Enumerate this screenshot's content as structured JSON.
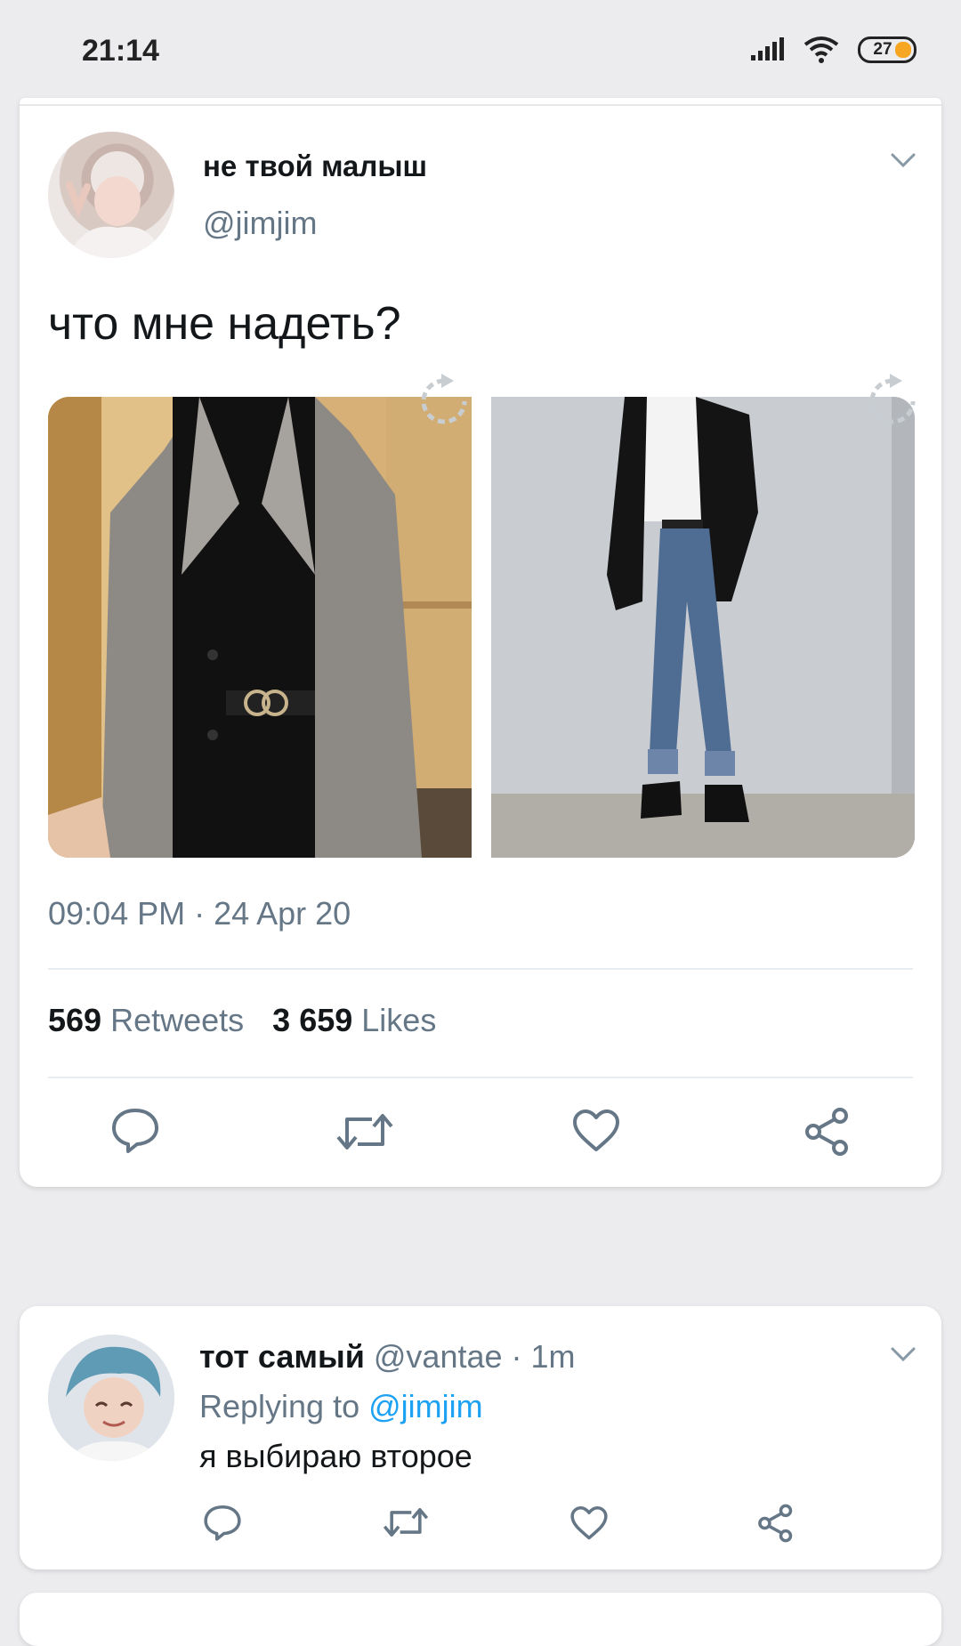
{
  "status_bar": {
    "time": "21:14",
    "battery": "27",
    "battery_color": "#f6a623"
  },
  "tweet": {
    "display_name": "не твой малыш",
    "handle": "@jimjim",
    "text": "что мне надеть?",
    "images": [
      {
        "icon": "refresh-icon"
      },
      {
        "icon": "refresh-icon"
      }
    ],
    "timestamp": "09:04 PM · 24 Apr 20",
    "stats": {
      "retweets_count": "569",
      "retweets_label": "Retweets",
      "likes_count": "3 659",
      "likes_label": "Likes"
    },
    "actions": [
      "reply-icon",
      "retweet-icon",
      "like-icon",
      "share-icon"
    ]
  },
  "reply": {
    "display_name": "тот самый",
    "handle": "@vantae",
    "time": "· 1m",
    "replying_prefix": "Replying to",
    "replying_to": "@jimjim",
    "text": "я выбираю второе",
    "actions": [
      "reply-icon",
      "retweet-icon",
      "like-icon",
      "share-icon"
    ]
  },
  "colors": {
    "link": "#1da1f2",
    "secondary_text": "#657786",
    "icon": "#657786"
  }
}
